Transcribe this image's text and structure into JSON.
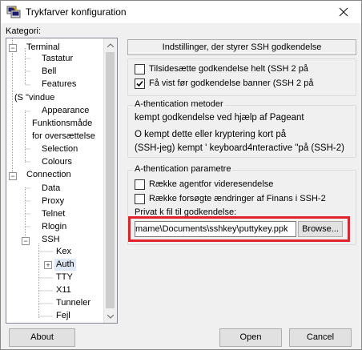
{
  "window": {
    "title": "Trykfarver konfiguration"
  },
  "category_label": "Kategori:",
  "tree": [
    {
      "label": "Terminal"
    },
    {
      "label": "Tastatur"
    },
    {
      "label": "Bell"
    },
    {
      "label": "Features"
    },
    {
      "label": "(S \"vindue"
    },
    {
      "label": "Appearance"
    },
    {
      "label": "Funktionsmåde"
    },
    {
      "label": "for oversættelse"
    },
    {
      "label": "Selection"
    },
    {
      "label": "Colours"
    },
    {
      "label": "Connection"
    },
    {
      "label": "Data"
    },
    {
      "label": "Proxy"
    },
    {
      "label": "Telnet"
    },
    {
      "label": "Rlogin"
    },
    {
      "label": "SSH"
    },
    {
      "label": "Kex"
    },
    {
      "label": "Auth"
    },
    {
      "label": "TTY"
    },
    {
      "label": "X11"
    },
    {
      "label": "Tunneler"
    },
    {
      "label": "Fejl"
    }
  ],
  "panel": {
    "header": "Indstillinger, der styrer SSH godkendelse",
    "checkboxes_top": [
      {
        "label": "Tilsidesætte godkendelse helt (SSH 2 på",
        "checked": false
      },
      {
        "label": "Få vist før godkendelse banner (SSH 2 på",
        "checked": true
      }
    ],
    "methods": {
      "title": "A-thentication metoder",
      "lines": [
        "kempt godkendelse ved hjælp af Pageant",
        "O kempt dette eller kryptering kort på",
        "(SSH-jeg) kempt ' keyboard4nteractive \"på (SSH-2)"
      ]
    },
    "params": {
      "title": "A-thentication parametre",
      "checkboxes": [
        {
          "label": "Række agentfor videresendelse",
          "checked": false
        },
        {
          "label": "Række forsøgte ændringer af Finans i SSH-2",
          "checked": false
        }
      ],
      "private_key_label": "Privat k fil til godkendelse:",
      "private_key_value": "mame\\Documents\\sshkey\\puttykey.ppk",
      "browse_label": "Browse..."
    }
  },
  "buttons": {
    "about": "About",
    "open": "Open",
    "cancel": "Cancel"
  },
  "colors": {
    "highlight": "#e0222b",
    "selection": "#dfe8f5"
  }
}
